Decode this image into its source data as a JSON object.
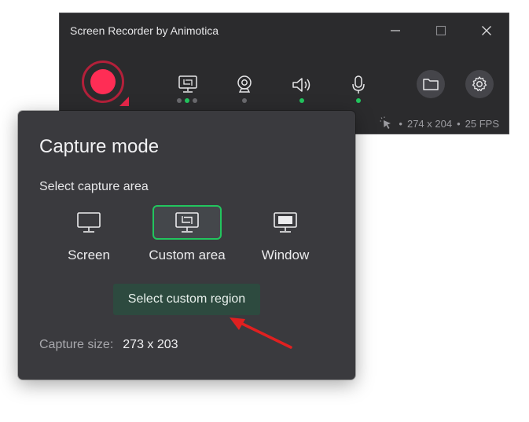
{
  "window": {
    "title": "Screen Recorder by Animotica",
    "minimize_icon": "minimize-icon",
    "maximize_icon": "maximize-icon",
    "close_icon": "close-icon"
  },
  "toolbar": {
    "record_icon": "record-icon",
    "tools": [
      {
        "name": "screen-capture",
        "icon": "monitor-crop-icon",
        "dots": [
          "off",
          "on",
          "off"
        ]
      },
      {
        "name": "webcam",
        "icon": "webcam-icon",
        "dots": [
          "off"
        ]
      },
      {
        "name": "system-audio",
        "icon": "speaker-icon",
        "dots": [
          "on"
        ]
      },
      {
        "name": "microphone",
        "icon": "microphone-icon",
        "dots": [
          "on"
        ]
      }
    ],
    "folder_icon": "folder-icon",
    "settings_icon": "gear-icon"
  },
  "status": {
    "resolution": "274 x 204",
    "fps": "25 FPS",
    "separator": "•",
    "cursor_icon": "cursor-click-icon"
  },
  "capture_panel": {
    "title": "Capture mode",
    "section_label": "Select capture area",
    "options": [
      {
        "label": "Screen",
        "icon": "monitor-icon",
        "selected": false
      },
      {
        "label": "Custom area",
        "icon": "monitor-crop-icon",
        "selected": true
      },
      {
        "label": "Window",
        "icon": "window-icon",
        "selected": false
      }
    ],
    "tooltip": "Select custom region",
    "capture_size_label": "Capture size:",
    "capture_size_value": "273 x 203"
  },
  "colors": {
    "window_bg": "#2b2b2d",
    "panel_bg": "#3a3a3e",
    "accent_green": "#22c55e",
    "record_red": "#ff2d55",
    "tooltip_bg": "#2d4a3f",
    "annotation_arrow": "#e02020"
  }
}
